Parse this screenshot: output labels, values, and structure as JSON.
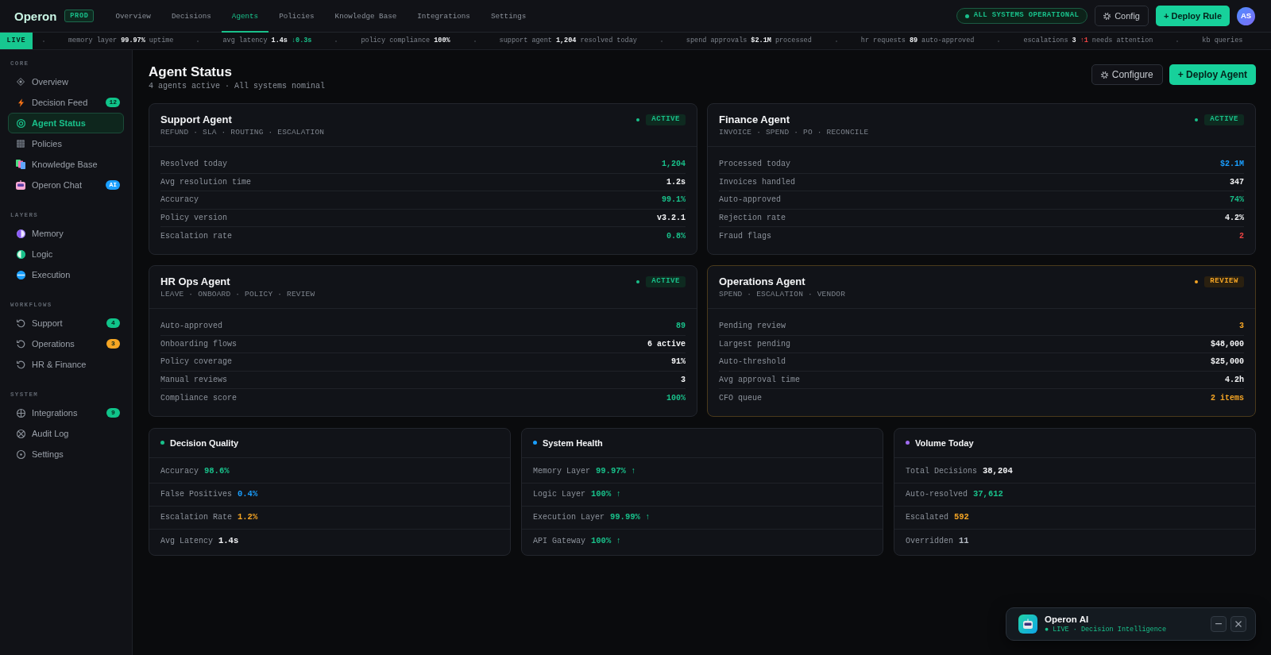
{
  "header": {
    "logo": "Operon",
    "env_badge": "PROD",
    "nav": [
      {
        "label": "Overview",
        "selected": false
      },
      {
        "label": "Decisions",
        "selected": false
      },
      {
        "label": "Agents",
        "selected": true
      },
      {
        "label": "Policies",
        "selected": false
      },
      {
        "label": "Knowledge Base",
        "selected": false
      },
      {
        "label": "Integrations",
        "selected": false
      },
      {
        "label": "Settings",
        "selected": false
      }
    ],
    "system_status": "ALL SYSTEMS OPERATIONAL",
    "buttons": [
      {
        "label": "Config",
        "kind": "secondary"
      },
      {
        "label": "+ Deploy Rule",
        "kind": "primary"
      }
    ],
    "avatar": "AS"
  },
  "ticker": {
    "badge": "LIVE",
    "items": [
      {
        "label": "memory layer",
        "value": "99.97%",
        "suffix": "uptime"
      },
      {
        "label": "avg latency",
        "value": "1.4s",
        "delta": {
          "text": "↓0.3s",
          "color": "#19c08a"
        }
      },
      {
        "label": "policy compliance",
        "value": "100%"
      },
      {
        "label": "support agent",
        "value": "1,204",
        "suffix": "resolved today"
      },
      {
        "label": "spend approvals",
        "value": "$2.1M",
        "suffix": "processed"
      },
      {
        "label": "hr requests",
        "value": "89",
        "suffix": "auto-approved"
      },
      {
        "label": "escalations",
        "value": "3",
        "delta": {
          "text": "↑1",
          "color": "#ef4444"
        },
        "suffix": "needs attention"
      },
      {
        "label": "kb queries"
      }
    ]
  },
  "sidebar": {
    "sections": [
      {
        "title": "CORE",
        "items": [
          {
            "label": "Overview",
            "selected": false
          },
          {
            "label": "Decision Feed",
            "selected": false,
            "badge": {
              "text": "12",
              "color": "#10c48a"
            }
          },
          {
            "label": "Agent Status",
            "selected": true
          },
          {
            "label": "Policies",
            "selected": false
          },
          {
            "label": "Knowledge Base",
            "selected": false
          },
          {
            "label": "Operon Chat",
            "selected": false,
            "badge": {
              "text": "AI",
              "color": "#1a9fff"
            }
          }
        ]
      },
      {
        "title": "LAYERS",
        "items": [
          {
            "label": "Memory",
            "selected": false
          },
          {
            "label": "Logic",
            "selected": false
          },
          {
            "label": "Execution",
            "selected": false
          }
        ]
      },
      {
        "title": "WORKFLOWS",
        "items": [
          {
            "label": "Support",
            "selected": false,
            "badge": {
              "text": "4",
              "color": "#10c48a"
            }
          },
          {
            "label": "Operations",
            "selected": false,
            "badge": {
              "text": "3",
              "color": "#f5a524"
            }
          },
          {
            "label": "HR & Finance",
            "selected": false
          }
        ]
      },
      {
        "title": "SYSTEM",
        "items": [
          {
            "label": "Integrations",
            "selected": false,
            "badge": {
              "text": "9",
              "color": "#10c48a"
            }
          },
          {
            "label": "Audit Log",
            "selected": false
          },
          {
            "label": "Settings",
            "selected": false
          }
        ]
      }
    ]
  },
  "page": {
    "title": "Agent Status",
    "subtitle": "4 agents active · All systems nominal",
    "buttons": [
      {
        "label": "Configure",
        "kind": "secondary"
      },
      {
        "label": "+ Deploy Agent",
        "kind": "primary"
      }
    ]
  },
  "agents": [
    {
      "name": "Support Agent",
      "tags": "REFUND · SLA · ROUTING · ESCALATION",
      "status": "ACTIVE",
      "needs_review": false,
      "metrics": [
        {
          "label": "Resolved today",
          "value": "1,204",
          "color": "#19c08a"
        },
        {
          "label": "Avg resolution time",
          "value": "1.2s",
          "color": "#f3f4f6"
        },
        {
          "label": "Accuracy",
          "value": "99.1%",
          "color": "#19c08a"
        },
        {
          "label": "Policy version",
          "value": "v3.2.1",
          "color": "#f3f4f6"
        },
        {
          "label": "Escalation rate",
          "value": "0.8%",
          "color": "#19c08a"
        }
      ]
    },
    {
      "name": "Finance Agent",
      "tags": "INVOICE · SPEND · PO · RECONCILE",
      "status": "ACTIVE",
      "needs_review": false,
      "metrics": [
        {
          "label": "Processed today",
          "value": "$2.1M",
          "color": "#1a9fff"
        },
        {
          "label": "Invoices handled",
          "value": "347",
          "color": "#f3f4f6"
        },
        {
          "label": "Auto-approved",
          "value": "74%",
          "color": "#19c08a"
        },
        {
          "label": "Rejection rate",
          "value": "4.2%",
          "color": "#f3f4f6"
        },
        {
          "label": "Fraud flags",
          "value": "2",
          "color": "#ef4444"
        }
      ]
    },
    {
      "name": "HR Ops Agent",
      "tags": "LEAVE · ONBOARD · POLICY · REVIEW",
      "status": "ACTIVE",
      "needs_review": false,
      "metrics": [
        {
          "label": "Auto-approved",
          "value": "89",
          "color": "#19c08a"
        },
        {
          "label": "Onboarding flows",
          "value": "6 active",
          "color": "#f3f4f6"
        },
        {
          "label": "Policy coverage",
          "value": "91%",
          "color": "#f3f4f6"
        },
        {
          "label": "Manual reviews",
          "value": "3",
          "color": "#f3f4f6"
        },
        {
          "label": "Compliance score",
          "value": "100%",
          "color": "#19c08a"
        }
      ]
    },
    {
      "name": "Operations Agent",
      "tags": "SPEND · ESCALATION · VENDOR",
      "status": "REVIEW",
      "needs_review": true,
      "metrics": [
        {
          "label": "Pending review",
          "value": "3",
          "color": "#f5a524"
        },
        {
          "label": "Largest pending",
          "value": "$48,000",
          "color": "#f3f4f6"
        },
        {
          "label": "Auto-threshold",
          "value": "$25,000",
          "color": "#f3f4f6"
        },
        {
          "label": "Avg approval time",
          "value": "4.2h",
          "color": "#f3f4f6"
        },
        {
          "label": "CFO queue",
          "value": "2 items",
          "color": "#f5a524"
        }
      ]
    }
  ],
  "summary_cards": [
    {
      "title": "Decision Quality",
      "color": "#19c08a",
      "rows": [
        {
          "label": "Accuracy",
          "value": "98.6%",
          "color": "#19c08a"
        },
        {
          "label": "False Positives",
          "value": "0.4%",
          "color": "#1a9fff"
        },
        {
          "label": "Escalation Rate",
          "value": "1.2%",
          "color": "#f5a524"
        },
        {
          "label": "Avg Latency",
          "value": "1.4s",
          "color": "#f3f4f6"
        }
      ]
    },
    {
      "title": "System Health",
      "color": "#1a9fff",
      "rows": [
        {
          "label": "Memory Layer",
          "value": "99.97% ↑",
          "color": "#19c08a"
        },
        {
          "label": "Logic Layer",
          "value": "100% ↑",
          "color": "#19c08a"
        },
        {
          "label": "Execution Layer",
          "value": "99.99% ↑",
          "color": "#19c08a"
        },
        {
          "label": "API Gateway",
          "value": "100% ↑",
          "color": "#19c08a"
        }
      ]
    },
    {
      "title": "Volume Today",
      "color": "#a06cf0",
      "rows": [
        {
          "label": "Total Decisions",
          "value": "38,204",
          "color": "#f3f4f6"
        },
        {
          "label": "Auto-resolved",
          "value": "37,612",
          "color": "#19c08a"
        },
        {
          "label": "Escalated",
          "value": "592",
          "color": "#f5a524"
        },
        {
          "label": "Overridden",
          "value": "11",
          "color": "#b4bac3"
        }
      ]
    }
  ],
  "chat_widget": {
    "title": "Operon AI",
    "status": "● LIVE · Decision Intelligence"
  }
}
